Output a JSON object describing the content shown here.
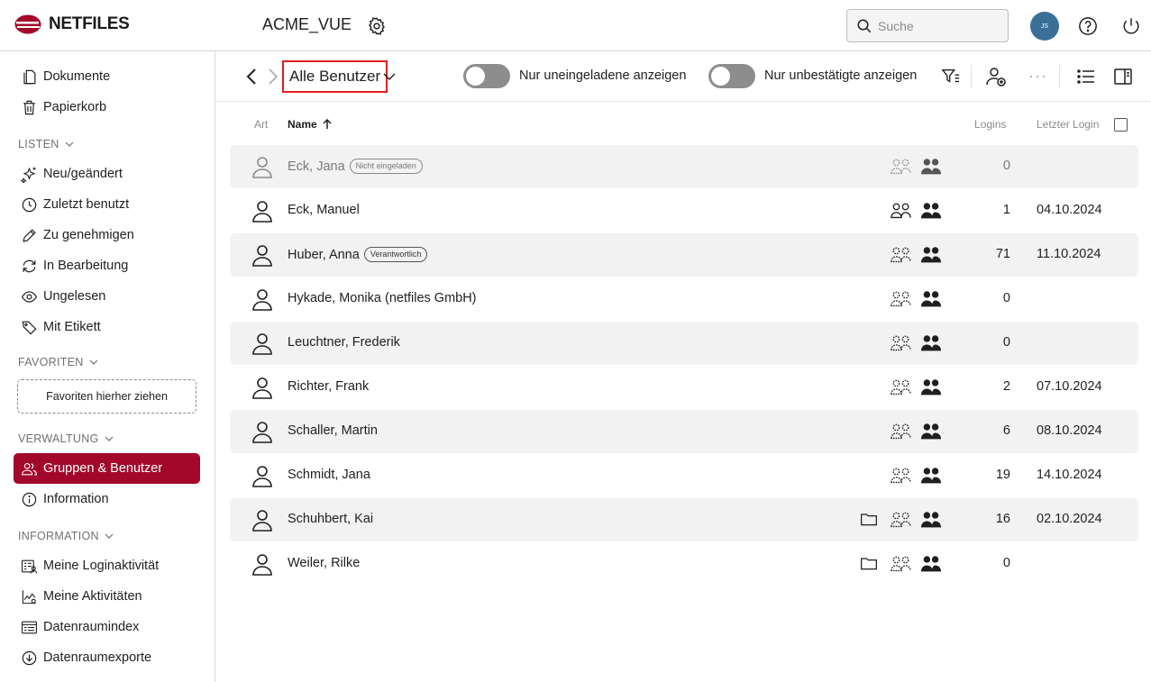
{
  "header": {
    "brand": "NETFILES",
    "room_title": "ACME_VUE",
    "search_placeholder": "Suche",
    "avatar_initials": "JS",
    "brand_color": "#a3082b",
    "avatar_color": "#3a6f98"
  },
  "sidebar": {
    "top_items": [
      {
        "label": "Dokumente",
        "icon": "document-icon"
      },
      {
        "label": "Papierkorb",
        "icon": "trash-icon"
      }
    ],
    "listen_label": "LISTEN",
    "listen_items": [
      {
        "label": "Neu/geändert",
        "icon": "sparkle-icon"
      },
      {
        "label": "Zuletzt benutzt",
        "icon": "clock-icon"
      },
      {
        "label": "Zu genehmigen",
        "icon": "pencil-icon"
      },
      {
        "label": "In Bearbeitung",
        "icon": "refresh-icon"
      },
      {
        "label": "Ungelesen",
        "icon": "eye-icon"
      },
      {
        "label": "Mit Etikett",
        "icon": "tag-icon"
      }
    ],
    "favoriten_label": "FAVORITEN",
    "favoriten_drop": "Favoriten hierher ziehen",
    "verwaltung_label": "VERWALTUNG",
    "verwaltung_items": [
      {
        "label": "Gruppen & Benutzer",
        "icon": "users-icon",
        "active": true
      },
      {
        "label": "Information",
        "icon": "info-icon"
      }
    ],
    "information_label": "INFORMATION",
    "information_items": [
      {
        "label": "Meine Loginaktivität",
        "icon": "login-activity-icon"
      },
      {
        "label": "Meine Aktivitäten",
        "icon": "activity-chart-icon"
      },
      {
        "label": "Datenraumindex",
        "icon": "index-icon"
      },
      {
        "label": "Datenraumexporte",
        "icon": "download-icon"
      }
    ]
  },
  "toolbar": {
    "view_label": "Alle Benutzer",
    "toggle_uninvited": "Nur uneingeladene anzeigen",
    "toggle_unconfirmed": "Nur unbestätigte anzeigen"
  },
  "table": {
    "headers": {
      "art": "Art",
      "name": "Name",
      "logins": "Logins",
      "last_login": "Letzter Login"
    },
    "rows": [
      {
        "name": "Eck, Jana",
        "badge": "Nicht eingeladen",
        "logins": "0",
        "last": "",
        "folder": false,
        "disabled": true
      },
      {
        "name": "Eck, Manuel",
        "badge": "",
        "logins": "1",
        "last": "04.10.2024",
        "folder": false,
        "disabled": false
      },
      {
        "name": "Huber, Anna",
        "badge": "Verantwortlich",
        "logins": "71",
        "last": "11.10.2024",
        "folder": false,
        "disabled": false
      },
      {
        "name": "Hykade, Monika (netfiles GmbH)",
        "badge": "",
        "logins": "0",
        "last": "",
        "folder": false,
        "disabled": false
      },
      {
        "name": "Leuchtner, Frederik",
        "badge": "",
        "logins": "0",
        "last": "",
        "folder": false,
        "disabled": false
      },
      {
        "name": "Richter, Frank",
        "badge": "",
        "logins": "2",
        "last": "07.10.2024",
        "folder": false,
        "disabled": false
      },
      {
        "name": "Schaller, Martin",
        "badge": "",
        "logins": "6",
        "last": "08.10.2024",
        "folder": false,
        "disabled": false
      },
      {
        "name": "Schmidt, Jana",
        "badge": "",
        "logins": "19",
        "last": "14.10.2024",
        "folder": false,
        "disabled": false
      },
      {
        "name": "Schuhbert, Kai",
        "badge": "",
        "logins": "16",
        "last": "02.10.2024",
        "folder": true,
        "disabled": false
      },
      {
        "name": "Weiler, Rilke",
        "badge": "",
        "logins": "0",
        "last": "",
        "folder": true,
        "disabled": false
      }
    ]
  }
}
